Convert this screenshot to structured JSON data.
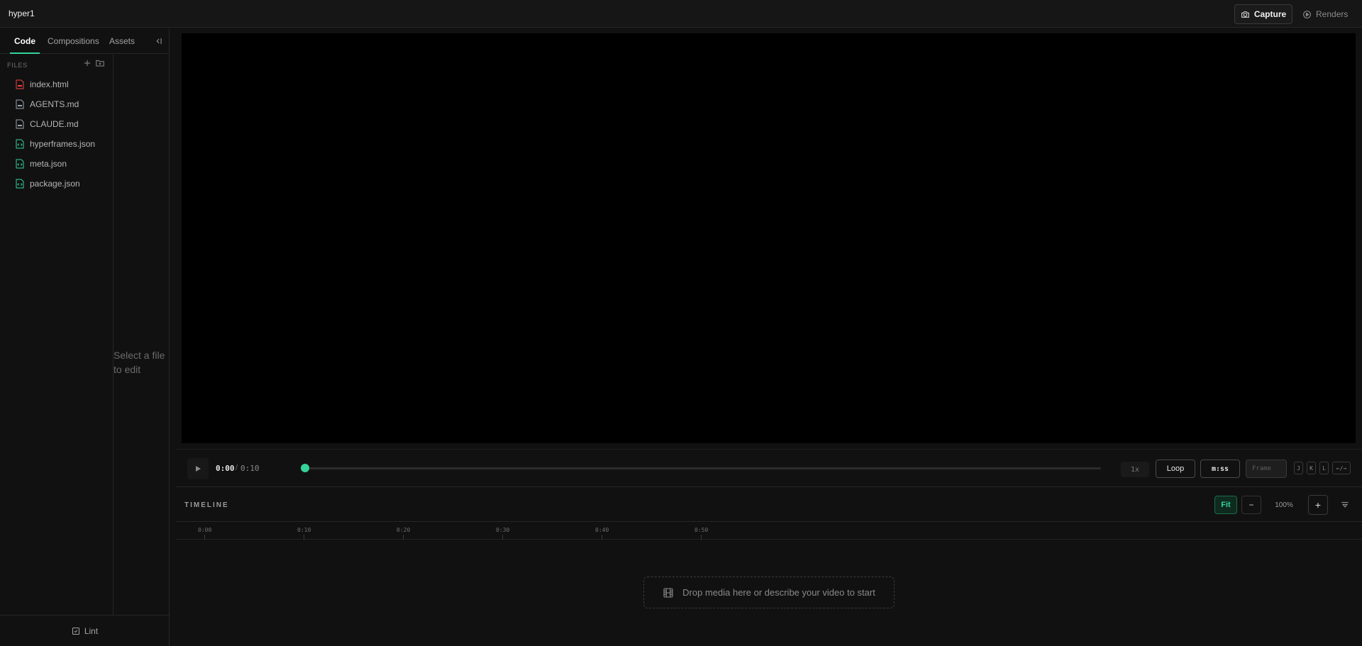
{
  "app": {
    "title": "hyper1"
  },
  "header": {
    "capture_label": "Capture",
    "renders_label": "Renders"
  },
  "sidebar": {
    "tabs": [
      {
        "label": "Code",
        "active": true
      },
      {
        "label": "Compositions",
        "active": false
      },
      {
        "label": "Assets",
        "active": false
      }
    ],
    "files_header": "FILES",
    "files": [
      {
        "name": "index.html",
        "icon": "html-file-icon",
        "color": "#ef4444"
      },
      {
        "name": "AGENTS.md",
        "icon": "markdown-file-icon",
        "color": "#9ca3af"
      },
      {
        "name": "CLAUDE.md",
        "icon": "markdown-file-icon",
        "color": "#9ca3af"
      },
      {
        "name": "hyperframes.json",
        "icon": "json-file-icon",
        "color": "#34d399"
      },
      {
        "name": "meta.json",
        "icon": "json-file-icon",
        "color": "#34d399"
      },
      {
        "name": "package.json",
        "icon": "json-file-icon",
        "color": "#34d399"
      }
    ],
    "editor_empty": "Select a file to edit",
    "lint_label": "Lint"
  },
  "player": {
    "current_time": "0:00",
    "separator": "/",
    "total_time": "0:10",
    "progress": 0,
    "speed": "1x",
    "loop_label": "Loop",
    "time_format": "m:ss",
    "frame_placeholder": "Frame",
    "key_hints": [
      "J",
      "K",
      "L",
      "←/→"
    ]
  },
  "timeline": {
    "title": "TIMELINE",
    "fit_label": "Fit",
    "zoom_out_label": "−",
    "zoom_level": "100%",
    "zoom_in_label": "+",
    "ruler_ticks": [
      "0:00",
      "0:10",
      "0:20",
      "0:30",
      "0:40",
      "0:50"
    ],
    "drop_prompt": "Drop media here or describe your video to start"
  },
  "colors": {
    "accent": "#34d399",
    "background": "#111111",
    "canvas": "#000000"
  }
}
